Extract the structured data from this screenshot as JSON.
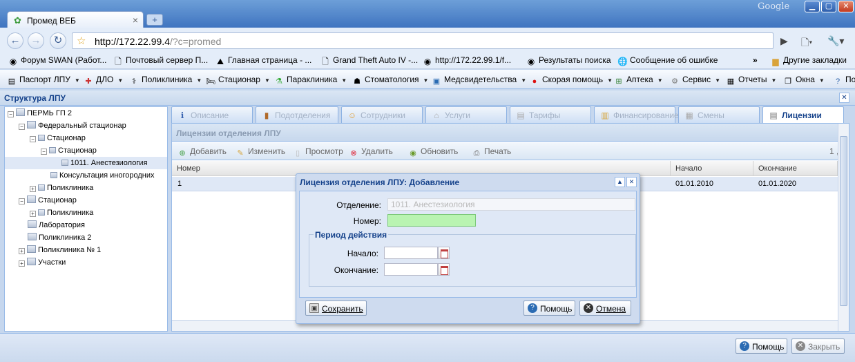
{
  "browser": {
    "tab_title": "Промед ВЕБ",
    "tab_close": "×",
    "new_tab": "+",
    "brand": "Google",
    "url_host": "http://172.22.99.4",
    "url_path": "/?c=promed"
  },
  "bookmarks": [
    {
      "label": "Форум SWAN (Работ..."
    },
    {
      "label": "Почтовый сервер П..."
    },
    {
      "label": "Главная страница - ..."
    },
    {
      "label": "Grand Theft Auto IV -..."
    },
    {
      "label": "http://172.22.99.1/f..."
    },
    {
      "label": "Результаты поиска"
    },
    {
      "label": "Сообщение об ошибке"
    },
    {
      "label": "Другие закладки"
    }
  ],
  "menu": [
    {
      "label": "Паспорт ЛПУ"
    },
    {
      "label": "ДЛО"
    },
    {
      "label": "Поликлиника"
    },
    {
      "label": "Стационар"
    },
    {
      "label": "Параклиника"
    },
    {
      "label": "Стоматология"
    },
    {
      "label": "Медсвидетельства"
    },
    {
      "label": "Скорая помощь"
    },
    {
      "label": "Аптека"
    },
    {
      "label": "Сервис"
    },
    {
      "label": "Отчеты"
    },
    {
      "label": "Окна"
    },
    {
      "label": "Помощь"
    }
  ],
  "panel": {
    "title": "Структура ЛПУ"
  },
  "tree": [
    {
      "label": "ПЕРМЬ ГП 2"
    },
    {
      "label": "Федеральный стационар"
    },
    {
      "label": "Стационар"
    },
    {
      "label": "Стационар"
    },
    {
      "label": "1011. Анестезиология"
    },
    {
      "label": "Консультация иногородних"
    },
    {
      "label": "Поликлиника"
    },
    {
      "label": "Стационар"
    },
    {
      "label": "Поликлиника"
    },
    {
      "label": "Лаборатория"
    },
    {
      "label": "Поликлиника 2"
    },
    {
      "label": "Поликлиника № 1"
    },
    {
      "label": "Участки"
    }
  ],
  "tabs": [
    {
      "label": "Описание"
    },
    {
      "label": "Подотделения"
    },
    {
      "label": "Сотрудники"
    },
    {
      "label": "Услуги"
    },
    {
      "label": "Тарифы"
    },
    {
      "label": "Финансирование"
    },
    {
      "label": "Смены"
    },
    {
      "label": "Лицензии"
    }
  ],
  "grid": {
    "title": "Лицензии отделения ЛПУ",
    "toolbar": {
      "add": "Добавить",
      "edit": "Изменить",
      "view": "Просмотр",
      "delete": "Удалить",
      "refresh": "Обновить",
      "print": "Печать",
      "paging": "1"
    },
    "columns": {
      "number": "Номер",
      "start": "Начало",
      "end": "Окончание"
    },
    "rows": [
      {
        "number": "1",
        "start": "01.01.2010",
        "end": "01.01.2020"
      }
    ]
  },
  "modal": {
    "title": "Лицензия отделения ЛПУ: Добавление",
    "department_label": "Отделение:",
    "department_value": "1011. Анестезиология",
    "number_label": "Номер:",
    "number_value": "",
    "period_legend": "Период действия",
    "start_label": "Начало:",
    "start_value": "",
    "end_label": "Окончание:",
    "end_value": "",
    "save": "Сохранить",
    "help": "Помощь",
    "cancel": "Отмена"
  },
  "footer": {
    "help": "Помощь",
    "close": "Закрыть"
  }
}
